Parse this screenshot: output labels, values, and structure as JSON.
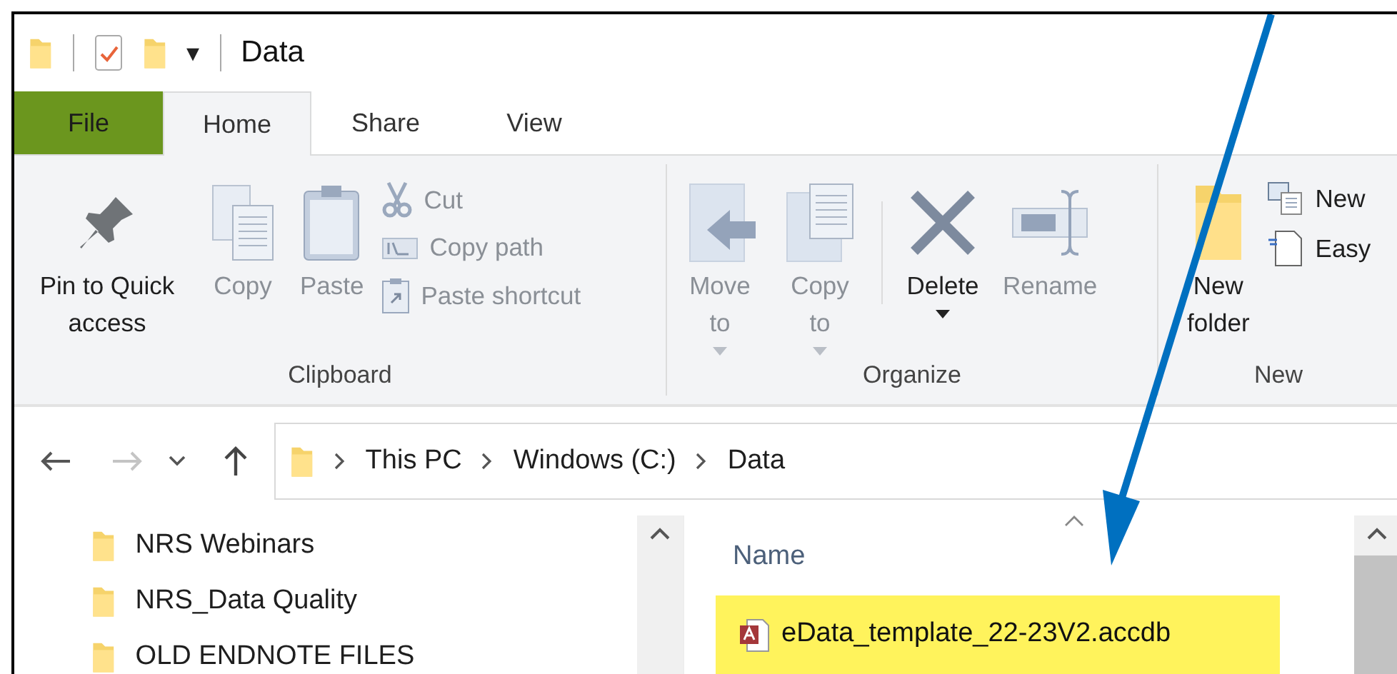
{
  "quick_access_toolbar": {
    "menu_glyph": "▾"
  },
  "window": {
    "title": "Data"
  },
  "tabs": [
    {
      "label": "File",
      "kind": "file",
      "selected": false
    },
    {
      "label": "Home",
      "kind": "tab",
      "selected": true
    },
    {
      "label": "Share",
      "kind": "tab",
      "selected": false
    },
    {
      "label": "View",
      "kind": "tab",
      "selected": false
    }
  ],
  "ribbon": {
    "groups": [
      {
        "label": "Clipboard",
        "items": [
          {
            "kind": "large",
            "label": "Pin to Quick access",
            "disabled": false
          },
          {
            "kind": "large",
            "label": "Copy",
            "disabled": true
          },
          {
            "kind": "large",
            "label": "Paste",
            "disabled": true
          },
          {
            "kind": "small",
            "label": "Cut",
            "disabled": true
          },
          {
            "kind": "small",
            "label": "Copy path",
            "disabled": true
          },
          {
            "kind": "small",
            "label": "Paste shortcut",
            "disabled": true
          }
        ]
      },
      {
        "label": "Organize",
        "items": [
          {
            "kind": "large",
            "label": "Move to",
            "disabled": true,
            "dropdown": true
          },
          {
            "kind": "large",
            "label": "Copy to",
            "disabled": true,
            "dropdown": true
          },
          {
            "kind": "separator"
          },
          {
            "kind": "large",
            "label": "Delete",
            "disabled": false,
            "dropdown": true
          },
          {
            "kind": "large",
            "label": "Rename",
            "disabled": true
          }
        ]
      },
      {
        "label": "New",
        "items": [
          {
            "kind": "large",
            "label": "New folder",
            "disabled": false
          },
          {
            "kind": "small",
            "label": "New",
            "disabled": false
          },
          {
            "kind": "small",
            "label": "Easy",
            "disabled": false
          }
        ]
      }
    ]
  },
  "address_bar": {
    "path": [
      "This PC",
      "Windows (C:)",
      "Data"
    ]
  },
  "sidebar": {
    "items": [
      {
        "label": "NRS Webinars"
      },
      {
        "label": "NRS_Data Quality"
      },
      {
        "label": "OLD ENDNOTE FILES"
      }
    ]
  },
  "file_list": {
    "columns": [
      {
        "label": "Name",
        "sorted": true
      }
    ],
    "rows": [
      {
        "name": "eData_template_22-23V2.accdb",
        "selected": true
      }
    ]
  },
  "annotation": {
    "kind": "arrow"
  }
}
